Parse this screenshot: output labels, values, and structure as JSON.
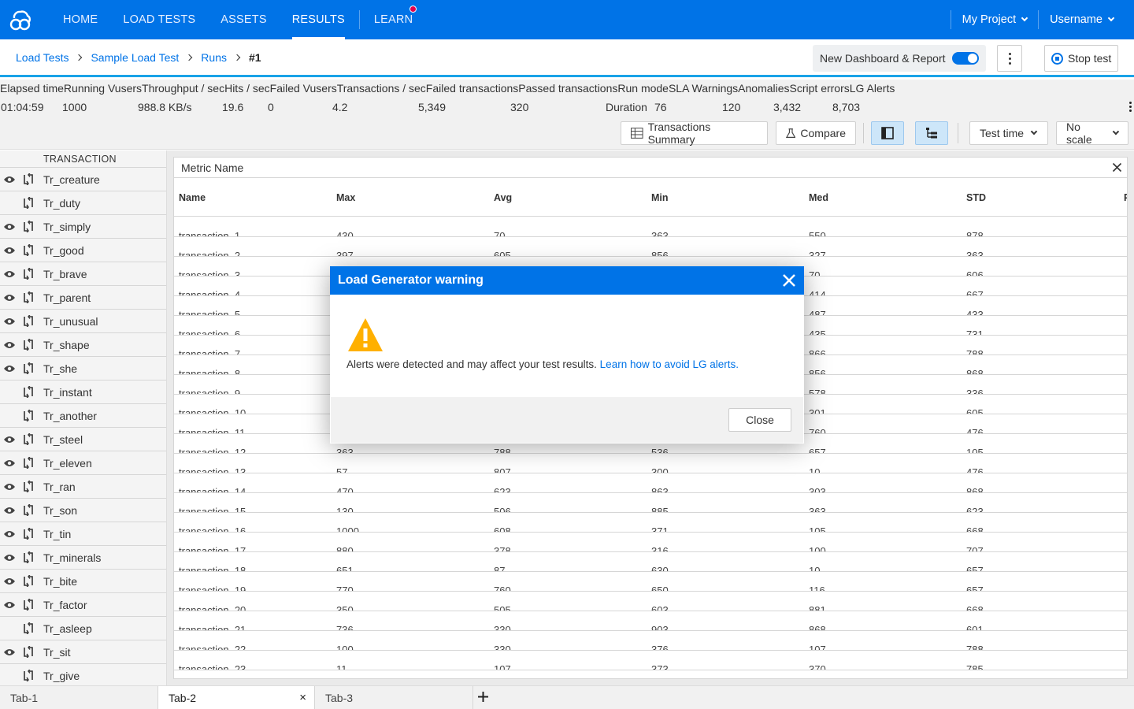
{
  "colors": {
    "brand": "#0073e7",
    "accent_line": "#1aa3e8",
    "notification": "#e5004c",
    "warning": "#ffb000"
  },
  "nav": {
    "items": [
      {
        "label": "HOME"
      },
      {
        "label": "LOAD TESTS"
      },
      {
        "label": "ASSETS"
      },
      {
        "label": "RESULTS",
        "active": true
      },
      {
        "label": "LEARN",
        "badge": true
      }
    ],
    "project": "My Project",
    "user": "Username"
  },
  "breadcrumb": {
    "items": [
      "Load Tests",
      "Sample Load Test",
      "Runs"
    ],
    "current": "#1"
  },
  "dashboard_toggle": {
    "label": "New Dashboard & Report",
    "on": true
  },
  "stop_button": "Stop test",
  "kpis": {
    "labels": "Elapsed timeRunning VusersThroughput / secHits / secFailed VusersTransactions / secFailed transactionsPassed transactionsRun modeSLA WarningsAnomaliesScript errorsLG Alerts",
    "values": {
      "elapsed": "01:04:59",
      "vusers": "1000",
      "throughput": "988.8 KB/s",
      "hits": "19.6",
      "failed_vusers": "0",
      "tps": "4.2",
      "failed_tx": "5,349",
      "passed_tx": "320",
      "run_mode": "Duration",
      "sla": "76",
      "anomalies": "120",
      "script_errors": "3,432",
      "lg_alerts": "8,703"
    }
  },
  "toolbar": {
    "summary": "Transactions Summary",
    "compare": "Compare",
    "time": "Test time",
    "scale": "No scale"
  },
  "tree": {
    "header": "TRANSACTION",
    "items": [
      {
        "label": "Tr_creature",
        "visible": true
      },
      {
        "label": "Tr_duty",
        "visible": false
      },
      {
        "label": "Tr_simply",
        "visible": true
      },
      {
        "label": "Tr_good",
        "visible": true
      },
      {
        "label": "Tr_brave",
        "visible": true
      },
      {
        "label": "Tr_parent",
        "visible": true
      },
      {
        "label": "Tr_unusual",
        "visible": true
      },
      {
        "label": "Tr_shape",
        "visible": true
      },
      {
        "label": "Tr_she",
        "visible": true
      },
      {
        "label": "Tr_instant",
        "visible": false
      },
      {
        "label": "Tr_another",
        "visible": false
      },
      {
        "label": "Tr_steel",
        "visible": true
      },
      {
        "label": "Tr_eleven",
        "visible": true
      },
      {
        "label": "Tr_ran",
        "visible": true
      },
      {
        "label": "Tr_son",
        "visible": true
      },
      {
        "label": "Tr_tin",
        "visible": true
      },
      {
        "label": "Tr_minerals",
        "visible": true
      },
      {
        "label": "Tr_bite",
        "visible": true
      },
      {
        "label": "Tr_factor",
        "visible": true
      },
      {
        "label": "Tr_asleep",
        "visible": false
      },
      {
        "label": "Tr_sit",
        "visible": true
      },
      {
        "label": "Tr_give",
        "visible": false
      }
    ]
  },
  "table": {
    "filter_label": "Metric Name",
    "columns": [
      "Name",
      "Max",
      "Avg",
      "Min",
      "Med",
      "STD",
      "P"
    ],
    "rows": [
      [
        "transaction_1",
        "430",
        "70",
        "363",
        "550",
        "878"
      ],
      [
        "transaction_2",
        "397",
        "605",
        "856",
        "327",
        "363"
      ],
      [
        "transaction_3",
        "",
        "",
        "",
        "70",
        "606"
      ],
      [
        "transaction_4",
        "",
        "",
        "",
        "414",
        "667"
      ],
      [
        "transaction_5",
        "",
        "",
        "",
        "487",
        "433"
      ],
      [
        "transaction_6",
        "",
        "",
        "",
        "435",
        "731"
      ],
      [
        "transaction_7",
        "",
        "",
        "",
        "866",
        "788"
      ],
      [
        "transaction_8",
        "",
        "",
        "",
        "856",
        "868"
      ],
      [
        "transaction_9",
        "",
        "",
        "",
        "578",
        "336"
      ],
      [
        "transaction_10",
        "",
        "",
        "",
        "301",
        "605"
      ],
      [
        "transaction_11",
        "",
        "",
        "",
        "760",
        "476"
      ],
      [
        "transaction_12",
        "363",
        "788",
        "536",
        "657",
        "105"
      ],
      [
        "transaction_13",
        "57",
        "807",
        "300",
        "10",
        "476"
      ],
      [
        "transaction_14",
        "470",
        "623",
        "863",
        "303",
        "868"
      ],
      [
        "transaction_15",
        "130",
        "506",
        "885",
        "363",
        "623"
      ],
      [
        "transaction_16",
        "1000",
        "608",
        "371",
        "105",
        "668"
      ],
      [
        "transaction_17",
        "880",
        "378",
        "316",
        "100",
        "707"
      ],
      [
        "transaction_18",
        "651",
        "87",
        "630",
        "10",
        "657"
      ],
      [
        "transaction_19",
        "770",
        "760",
        "650",
        "116",
        "657"
      ],
      [
        "transaction_20",
        "350",
        "505",
        "603",
        "881",
        "668"
      ],
      [
        "transaction_21",
        "736",
        "330",
        "903",
        "868",
        "601"
      ],
      [
        "transaction_22",
        "100",
        "330",
        "376",
        "107",
        "788"
      ],
      [
        "transaction_23",
        "11",
        "107",
        "373",
        "370",
        "785"
      ]
    ]
  },
  "tabs": [
    {
      "label": "Tab-1"
    },
    {
      "label": "Tab-2",
      "active": true
    },
    {
      "label": "Tab-3"
    }
  ],
  "modal": {
    "title": "Load Generator warning",
    "message": "Alerts were detected and may affect your test results.",
    "link": "Learn how to avoid LG alerts.",
    "close": "Close"
  }
}
